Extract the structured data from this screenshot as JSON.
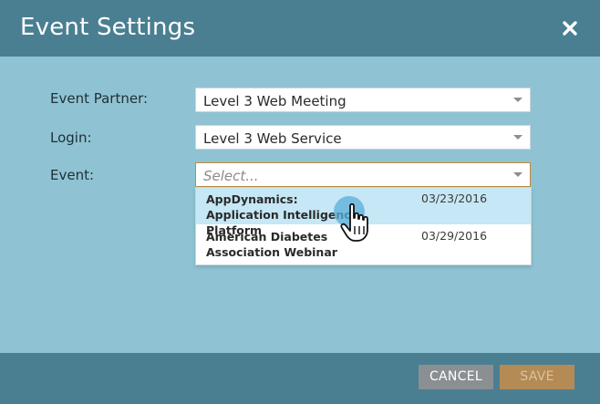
{
  "dialog": {
    "title": "Event Settings"
  },
  "fields": {
    "partner_label": "Event Partner:",
    "partner_value": "Level 3 Web Meeting",
    "login_label": "Login:",
    "login_value": "Level 3 Web Service",
    "event_label": "Event:",
    "event_placeholder": "Select..."
  },
  "dropdown": {
    "options": [
      {
        "name": "AppDynamics: Application Intelligence Platform",
        "date": "03/23/2016"
      },
      {
        "name": "American Diabetes Association Webinar",
        "date": "03/29/2016"
      }
    ]
  },
  "footer": {
    "cancel_label": "CANCEL",
    "save_label": "SAVE"
  },
  "colors": {
    "header": "#4a7f92",
    "body": "#8fc3d3",
    "hover_option": "#c6e7f5",
    "save_button": "#b48a55",
    "cancel_button": "#8a8f92"
  },
  "icons": {
    "close": "close-icon",
    "dropdown_caret": "chevron-down-icon",
    "cursor": "hand-pointer-icon"
  }
}
